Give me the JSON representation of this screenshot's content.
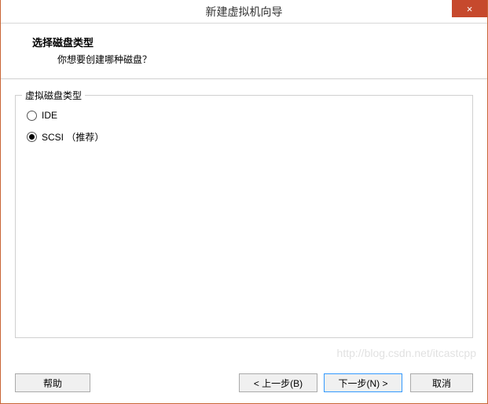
{
  "titlebar": {
    "title": "新建虚拟机向导",
    "close_symbol": "×"
  },
  "header": {
    "title": "选择磁盘类型",
    "subtitle": "你想要创建哪种磁盘？"
  },
  "fieldset": {
    "legend": "虚拟磁盘类型",
    "options": [
      {
        "label": "IDE",
        "selected": false
      },
      {
        "label": "SCSI （推荐）",
        "selected": true
      }
    ]
  },
  "buttons": {
    "help": "帮助",
    "back": "< 上一步(B)",
    "next": "下一步(N) >",
    "cancel": "取消"
  },
  "watermark": "http://blog.csdn.net/itcastcpp"
}
